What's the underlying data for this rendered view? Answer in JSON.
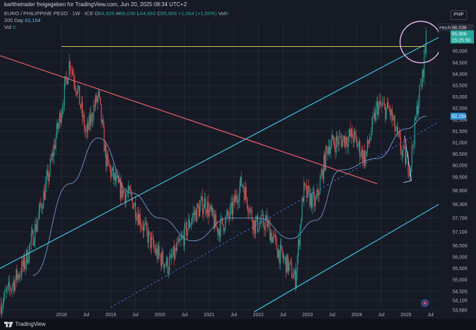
{
  "header": {
    "title": "karlthetrader freigegeben for TradingView.com, Jun 20, 2025 08:34 UTC+2"
  },
  "legend": {
    "symbol": "EURO / PHILIPPINE PESO · 1W · ICE",
    "open_label": "O",
    "open": "64,829",
    "high_label": "H",
    "high": "66,036",
    "low_label": "L",
    "low": "64,693",
    "close_label": "C",
    "close": "65,906",
    "change": "+1,004 (+1,55%)",
    "vol_label": "Vol",
    "vol_value": "0",
    "ma_label": "200 Day",
    "ma_value": "62,154",
    "vol2_label": "Vol",
    "vol2_value": "0"
  },
  "currency": "PHP",
  "price_axis": {
    "ticks": [
      "65,000",
      "64,500",
      "64,000",
      "63,500",
      "63,000",
      "62,500",
      "62,000",
      "61,500",
      "61,000",
      "60,500",
      "60,000",
      "59,500",
      "58,900",
      "58,300",
      "57,700",
      "57,100",
      "56,500",
      "56,000",
      "55,500",
      "55,000",
      "54,500",
      "54,100",
      "53,680"
    ],
    "high_tag_label": "Hoch",
    "high_tag_value": "66,036",
    "price_tag_value": "65,906",
    "countdown": "15:25:50",
    "ma_tag_value": "62,154"
  },
  "time_axis": {
    "labels": [
      "2018",
      "Jul",
      "2019",
      "Jul",
      "2020",
      "Jul",
      "2021",
      "Jul",
      "2022",
      "Jul",
      "2023",
      "Jul",
      "2024",
      "Jul",
      "2025",
      "Jul"
    ]
  },
  "footer": {
    "brand": "TradingView"
  },
  "colors": {
    "background": "#161a25",
    "up": "#26a69a",
    "down": "#ef5350",
    "channel": "#3ec6e0",
    "red_trendline": "#f0606e",
    "resistance": "#d4c242",
    "ma": "#6f9ccf",
    "circle": "#e3b6e8",
    "price_tag": "#26a69a",
    "ma_tag": "#2f8fd4"
  },
  "chart_data": {
    "type": "candlestick",
    "title": "EURO / PHILIPPINE PESO · 1W · ICE",
    "xlabel": "",
    "ylabel": "",
    "ylim": [
      53.68,
      66.3
    ],
    "x_range": [
      "2016-10",
      "2025-09"
    ],
    "series": [
      {
        "name": "EURPHP (approx. close path)",
        "points": [
          [
            "2016-10",
            53.9
          ],
          [
            "2017-01",
            54.8
          ],
          [
            "2017-04",
            55.7
          ],
          [
            "2017-07",
            57.5
          ],
          [
            "2017-10",
            59.7
          ],
          [
            "2018-01",
            62.5
          ],
          [
            "2018-03",
            64.6
          ],
          [
            "2018-05",
            63.2
          ],
          [
            "2018-07",
            61.3
          ],
          [
            "2018-09",
            62.6
          ],
          [
            "2018-10",
            63.0
          ],
          [
            "2018-12",
            60.1
          ],
          [
            "2019-03",
            59.0
          ],
          [
            "2019-06",
            58.6
          ],
          [
            "2019-09",
            57.3
          ],
          [
            "2019-12",
            56.2
          ],
          [
            "2020-03",
            55.6
          ],
          [
            "2020-06",
            56.6
          ],
          [
            "2020-09",
            57.8
          ],
          [
            "2020-12",
            58.4
          ],
          [
            "2021-03",
            57.2
          ],
          [
            "2021-06",
            57.8
          ],
          [
            "2021-09",
            59.3
          ],
          [
            "2021-12",
            57.4
          ],
          [
            "2022-03",
            57.5
          ],
          [
            "2022-06",
            56.2
          ],
          [
            "2022-09",
            55.4
          ],
          [
            "2022-10",
            55.0
          ],
          [
            "2022-12",
            58.9
          ],
          [
            "2023-03",
            58.3
          ],
          [
            "2023-06",
            60.9
          ],
          [
            "2023-09",
            61.1
          ],
          [
            "2023-12",
            61.3
          ],
          [
            "2024-03",
            60.3
          ],
          [
            "2024-06",
            62.6
          ],
          [
            "2024-09",
            62.4
          ],
          [
            "2024-12",
            60.6
          ],
          [
            "2025-02",
            59.9
          ],
          [
            "2025-04",
            62.9
          ],
          [
            "2025-05",
            63.8
          ],
          [
            "2025-06",
            65.9
          ]
        ]
      },
      {
        "name": "200 Day",
        "points": [
          [
            "2017-06",
            55.2
          ],
          [
            "2018-03",
            59.2
          ],
          [
            "2018-10",
            61.2
          ],
          [
            "2019-06",
            58.8
          ],
          [
            "2020-01",
            57.7
          ],
          [
            "2020-09",
            56.7
          ],
          [
            "2021-06",
            57.7
          ],
          [
            "2022-01",
            57.7
          ],
          [
            "2022-09",
            56.8
          ],
          [
            "2023-03",
            57.6
          ],
          [
            "2023-09",
            59.8
          ],
          [
            "2024-06",
            60.3
          ],
          [
            "2025-01",
            61.6
          ],
          [
            "2025-06",
            62.154
          ]
        ]
      }
    ],
    "last": {
      "open": 64.829,
      "high": 66.036,
      "low": 64.693,
      "close": 65.906,
      "change": 1.004,
      "change_pct": 1.55
    },
    "high_line": 65.2,
    "drawings": [
      {
        "kind": "trendline",
        "color": "red",
        "from": [
          "2016-10",
          64.8
        ],
        "to": [
          "2024-06",
          59.2
        ]
      },
      {
        "kind": "channel-upper",
        "color": "cyan",
        "from": [
          "2016-10",
          55.5
        ],
        "to": [
          "2025-09",
          65.6
        ]
      },
      {
        "kind": "channel-middle-dashed",
        "color": "blue",
        "from": [
          "2019-01",
          53.8
        ],
        "to": [
          "2025-09",
          61.9
        ]
      },
      {
        "kind": "channel-lower",
        "color": "cyan",
        "from": [
          "2021-12",
          53.6
        ],
        "to": [
          "2025-09",
          58.3
        ]
      }
    ],
    "grid": true
  }
}
